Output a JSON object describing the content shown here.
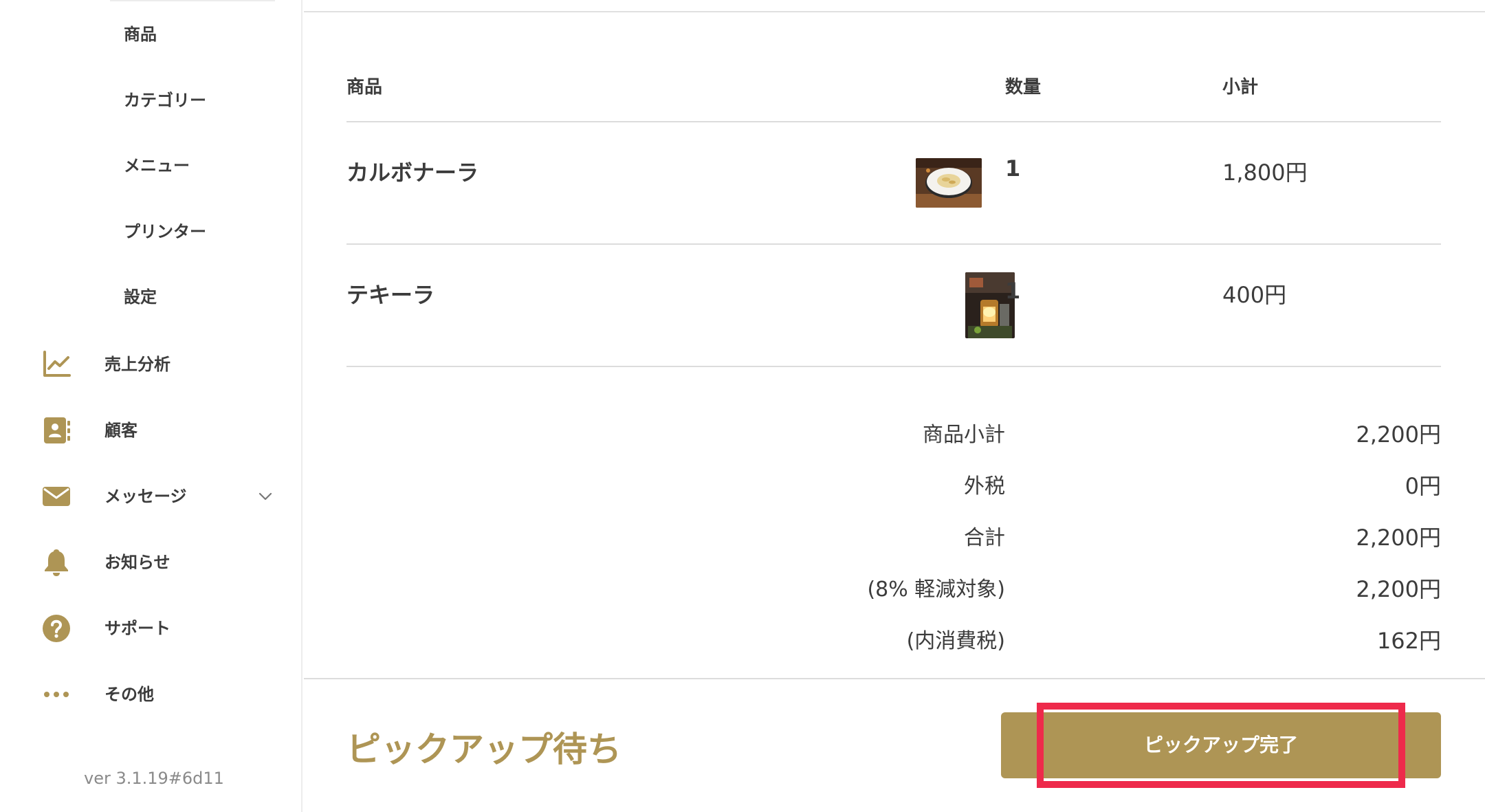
{
  "sidebar": {
    "sub_items": [
      {
        "label": "商品"
      },
      {
        "label": "カテゴリー"
      },
      {
        "label": "メニュー"
      },
      {
        "label": "プリンター"
      },
      {
        "label": "設定"
      }
    ],
    "items": [
      {
        "label": "売上分析",
        "icon": "chart-line-icon"
      },
      {
        "label": "顧客",
        "icon": "contact-book-icon"
      },
      {
        "label": "メッセージ",
        "icon": "envelope-icon",
        "expandable": true
      },
      {
        "label": "お知らせ",
        "icon": "bell-icon"
      },
      {
        "label": "サポート",
        "icon": "question-circle-icon"
      },
      {
        "label": "その他",
        "icon": "more-dots-icon"
      }
    ],
    "version": "ver 3.1.19#6d11"
  },
  "order": {
    "headers": {
      "product": "商品",
      "quantity": "数量",
      "subtotal": "小計"
    },
    "items": [
      {
        "name": "カルボナーラ",
        "quantity": "1",
        "subtotal": "1,800円",
        "image": "carbonara-photo"
      },
      {
        "name": "テキーラ",
        "quantity": "1",
        "subtotal": "400円",
        "image": "tequila-photo"
      }
    ],
    "summary": [
      {
        "label": "商品小計",
        "value": "2,200円"
      },
      {
        "label": "外税",
        "value": "0円"
      },
      {
        "label": "合計",
        "value": "2,200円"
      },
      {
        "label": "(8% 軽減対象)",
        "value": "2,200円"
      },
      {
        "label": "(内消費税)",
        "value": "162円"
      }
    ]
  },
  "footer": {
    "status": "ピックアップ待ち",
    "complete_button": "ピックアップ完了"
  },
  "colors": {
    "accent": "#ae9555",
    "text": "#3c3c3c",
    "highlight": "#ee2a4b",
    "divider": "#dcdcdc"
  }
}
